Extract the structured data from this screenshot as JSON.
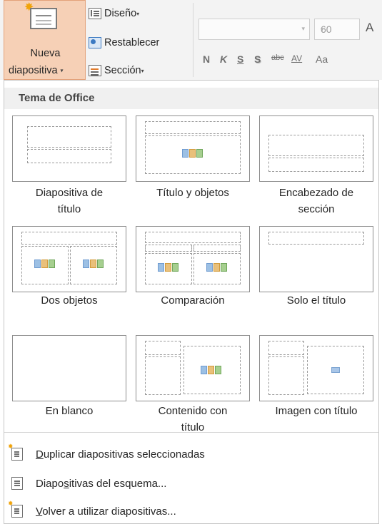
{
  "ribbon": {
    "nueva": {
      "line1": "Nueva",
      "line2": "diapositiva",
      "caret": "▾"
    },
    "diseno": "Diseño",
    "restablecer": "Restablecer",
    "seccion": "Sección",
    "caret": "▾",
    "font_size": "60",
    "grow_font": "A",
    "format_buttons": [
      "N",
      "K",
      "S",
      "S",
      "abc",
      "AV",
      "Aa"
    ]
  },
  "menu": {
    "header": "Tema de Office",
    "layouts": [
      {
        "label_line1": "Diapositiva de",
        "label_line2": "título"
      },
      {
        "label_line1": "Título y objetos",
        "label_line2": ""
      },
      {
        "label_line1": "Encabezado de",
        "label_line2": "sección"
      },
      {
        "label_line1": "Dos objetos",
        "label_line2": ""
      },
      {
        "label_line1": "Comparación",
        "label_line2": ""
      },
      {
        "label_line1": "Solo el título",
        "label_line2": ""
      },
      {
        "label_line1": "En blanco",
        "label_line2": ""
      },
      {
        "label_line1": "Contenido con",
        "label_line2": "título"
      },
      {
        "label_line1": "Imagen con título",
        "label_line2": ""
      }
    ],
    "commands": [
      {
        "underline": "D",
        "rest": "uplicar diapositivas seleccionadas"
      },
      {
        "pre": "Diapo",
        "underline": "s",
        "rest": "itivas del esquema..."
      },
      {
        "underline": "V",
        "rest": "olver a utilizar diapositivas..."
      }
    ]
  }
}
